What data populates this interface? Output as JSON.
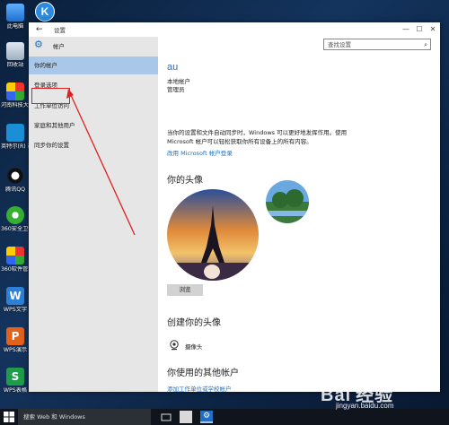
{
  "desktop": {
    "icons": [
      {
        "label": "此电脑",
        "name": "this-pc-icon"
      },
      {
        "label": "回收站",
        "name": "recycle-bin-icon"
      },
      {
        "label": "河南科技大学认...",
        "name": "henan-keji-icon"
      },
      {
        "label": "英特尔(R) 视图(T...",
        "name": "intel-view-icon"
      },
      {
        "label": "腾讯QQ",
        "name": "qq-icon"
      },
      {
        "label": "360安全卫士",
        "name": "360-guard-icon"
      },
      {
        "label": "360软件管家",
        "name": "360-software-icon"
      },
      {
        "label": "WPS文字",
        "name": "wps-writer-icon"
      },
      {
        "label": "WPS演示",
        "name": "wps-presentation-icon"
      },
      {
        "label": "WPS表格",
        "name": "wps-spreadsheet-icon"
      }
    ],
    "app_letter": "K"
  },
  "window": {
    "title": "设置",
    "back_glyph": "←",
    "minimize_glyph": "—",
    "maximize_glyph": "☐",
    "close_glyph": "✕"
  },
  "sidebar": {
    "header_label": "帐户",
    "items": [
      {
        "label": "你的帐户",
        "active": true
      },
      {
        "label": "登录选项",
        "active": false
      },
      {
        "label": "工作单位访问",
        "active": false
      },
      {
        "label": "家庭和其他用户",
        "active": false
      },
      {
        "label": "同步你的设置",
        "active": false
      }
    ]
  },
  "search": {
    "placeholder": "查找设置"
  },
  "account": {
    "name": "au",
    "type": "本地帐户",
    "role": "管理员",
    "description": "当你的设置和文件自动同步时，Windows 可以更好地发挥作用。使用 Microsoft 帐户可以轻松获取你所有设备上的所有内容。",
    "switch_link": "改用 Microsoft 帐户登录"
  },
  "avatar": {
    "section_title": "你的头像",
    "browse_label": "浏览"
  },
  "create_avatar": {
    "section_title": "创建你的头像",
    "camera_label": "摄像头"
  },
  "other_accounts": {
    "section_title": "你使用的其他帐户",
    "add_link": "添加工作单位或学校帐户"
  },
  "taskbar": {
    "search_text": "搜索 Web 和 Windows"
  },
  "watermark": {
    "logo_text": "Bai 经验",
    "site": "jingyan.baidu.com"
  },
  "colors": {
    "accent": "#1a6fc4",
    "sidebar_active": "#a9c7e8",
    "highlight": "#e02020"
  }
}
